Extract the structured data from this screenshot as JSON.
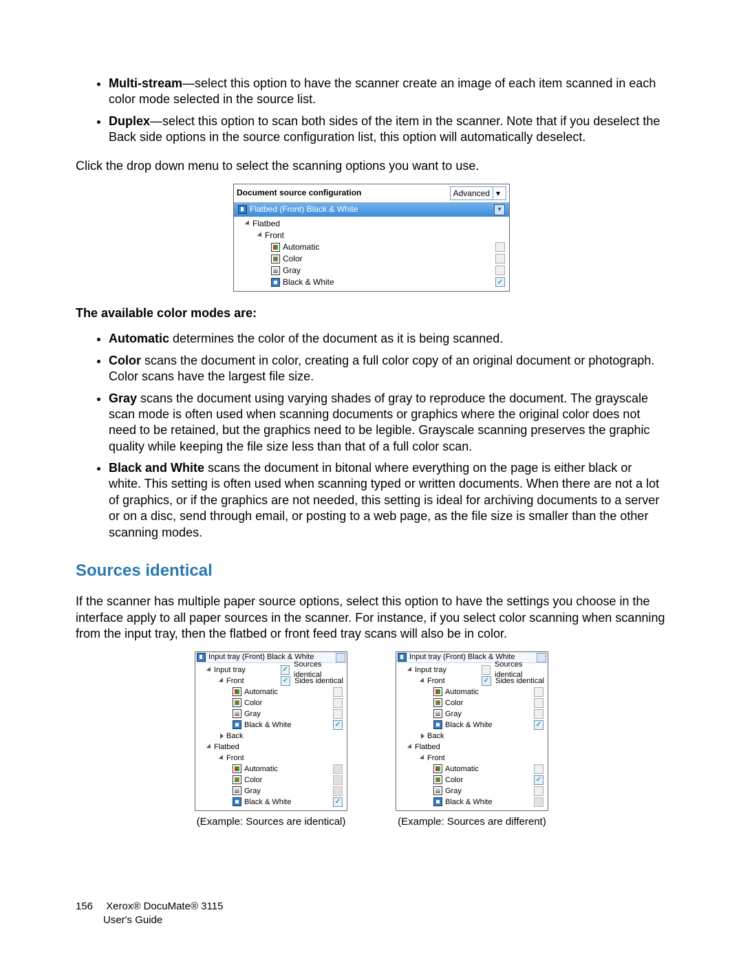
{
  "intro_bullets": [
    {
      "b": "Multi-stream",
      "t": "—select this option to have the scanner create an image of each item scanned in each color mode selected in the source list."
    },
    {
      "b": "Duplex",
      "t": "—select this option to scan both sides of the item in the scanner. Note that if you deselect the Back side options in the source configuration list, this option will automatically deselect."
    }
  ],
  "dropdown_intro": "Click the drop down menu to select the scanning options you want to use.",
  "shot1": {
    "title": "Document source configuration",
    "button": "Advanced",
    "selected": "Flatbed (Front) Black & White",
    "root": "Flatbed",
    "side": "Front",
    "modes": [
      "Automatic",
      "Color",
      "Gray",
      "Black & White"
    ]
  },
  "modes_intro": "The available color modes are:",
  "mode_bullets": [
    {
      "b": "Automatic",
      "t": " determines the color of the document as it is being scanned."
    },
    {
      "b": "Color",
      "t": " scans the document in color, creating a full color copy of an original document or photograph. Color scans have the largest file size."
    },
    {
      "b": "Gray",
      "t": " scans the document using varying shades of gray to reproduce the document. The grayscale scan mode is often used when scanning documents or graphics where the original color does not need to be retained, but the graphics need to be legible. Grayscale scanning preserves the graphic quality while keeping the file size less than that of a full color scan."
    },
    {
      "b": "Black and White",
      "t": " scans the document in bitonal where everything on the page is either black or white. This setting is often used when scanning typed or written documents. When there are not a lot of graphics, or if the graphics are not needed, this setting is ideal for archiving documents to a server or on a disc, send through email, or posting to a web page, as the file size is smaller than the other scanning modes."
    }
  ],
  "section_title": "Sources identical",
  "section_para": "If the scanner has multiple paper source options, select this option to have the settings you choose in the interface apply to all paper sources in the scanner. For instance, if you select color scanning when scanning from the input tray, then the flatbed or front feed tray scans will also be in color.",
  "examples": {
    "left": {
      "selected": "Input tray (Front) Black & White",
      "tree": {
        "input_tray": "Input tray",
        "flatbed": "Flatbed",
        "front": "Front",
        "back": "Back",
        "modes": [
          "Automatic",
          "Color",
          "Gray",
          "Black & White"
        ]
      },
      "sources_identical": {
        "label": "Sources identical",
        "checked": true
      },
      "sides_identical": {
        "label": "Sides identical",
        "checked": true
      },
      "flatbed_bw_checked": true,
      "flatbed_color_checked": false,
      "caption": "(Example: Sources are identical)"
    },
    "right": {
      "selected": "Input tray (Front) Black & White",
      "tree": {
        "input_tray": "Input tray",
        "flatbed": "Flatbed",
        "front": "Front",
        "back": "Back",
        "modes": [
          "Automatic",
          "Color",
          "Gray",
          "Black & White"
        ]
      },
      "sources_identical": {
        "label": "Sources identical",
        "checked": false
      },
      "sides_identical": {
        "label": "Sides identical",
        "checked": true
      },
      "flatbed_bw_checked": false,
      "flatbed_color_checked": true,
      "caption": "(Example: Sources are different)"
    }
  },
  "footer": {
    "page": "156",
    "line1": "Xerox® DocuMate® 3115",
    "line2": "User's Guide"
  }
}
